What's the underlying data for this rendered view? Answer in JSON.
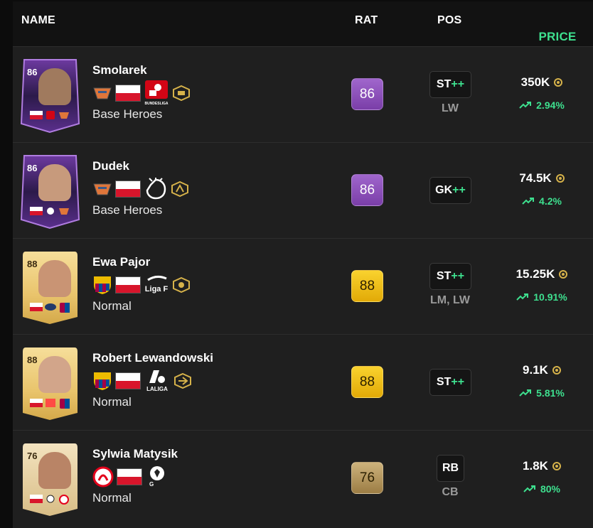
{
  "header": {
    "name_label": "NAME",
    "rat_label": "RAT",
    "pos_label": "POS",
    "price_label": "PRICE",
    "sort_icon": "chevron-down-icon"
  },
  "colors": {
    "accent_green": "#3ee08f",
    "hero_purple": "#8a4bb8",
    "gold": "#f5c518",
    "bronze_gold": "#b8965a"
  },
  "players": [
    {
      "card_rating": "86",
      "name": "Smolarek",
      "version": "Base Heroes",
      "rating": "86",
      "position": "ST",
      "position_plus": "++",
      "alt_positions": "LW",
      "price": "350K",
      "change": "2.94%",
      "club_icon": "heroes-club-icon",
      "nation_icon": "poland-flag-icon",
      "league_icon": "bundesliga-icon",
      "league_text": "BUNDESLIGA",
      "playstyle_icon": "playstyle-icon"
    },
    {
      "card_rating": "86",
      "name": "Dudek",
      "version": "Base Heroes",
      "rating": "86",
      "position": "GK",
      "position_plus": "++",
      "alt_positions": "",
      "price": "74.5K",
      "change": "4.2%",
      "club_icon": "heroes-club-icon",
      "nation_icon": "poland-flag-icon",
      "league_icon": "premier-league-icon",
      "league_text": "",
      "playstyle_icon": "playstyle-icon"
    },
    {
      "card_rating": "88",
      "name": "Ewa Pajor",
      "version": "Normal",
      "rating": "88",
      "position": "ST",
      "position_plus": "++",
      "alt_positions": "LM, LW",
      "price": "15.25K",
      "change": "10.91%",
      "club_icon": "barcelona-crest-icon",
      "nation_icon": "poland-flag-icon",
      "league_icon": "liga-f-icon",
      "league_text": "Liga F",
      "playstyle_icon": "playstyle-icon"
    },
    {
      "card_rating": "88",
      "name": "Robert Lewandowski",
      "version": "Normal",
      "rating": "88",
      "position": "ST",
      "position_plus": "++",
      "alt_positions": "",
      "price": "9.1K",
      "change": "5.81%",
      "club_icon": "barcelona-crest-icon",
      "nation_icon": "poland-flag-icon",
      "league_icon": "laliga-icon",
      "league_text": "LALIGA",
      "playstyle_icon": "playstyle-icon"
    },
    {
      "card_rating": "76",
      "name": "Sylwia Matysik",
      "version": "Normal",
      "rating": "76",
      "position": "RB",
      "position_plus": "",
      "alt_positions": "CB",
      "price": "1.8K",
      "change": "80%",
      "club_icon": "koln-crest-icon",
      "nation_icon": "poland-flag-icon",
      "league_icon": "frauen-bundesliga-icon",
      "league_text": "",
      "playstyle_icon": ""
    }
  ]
}
